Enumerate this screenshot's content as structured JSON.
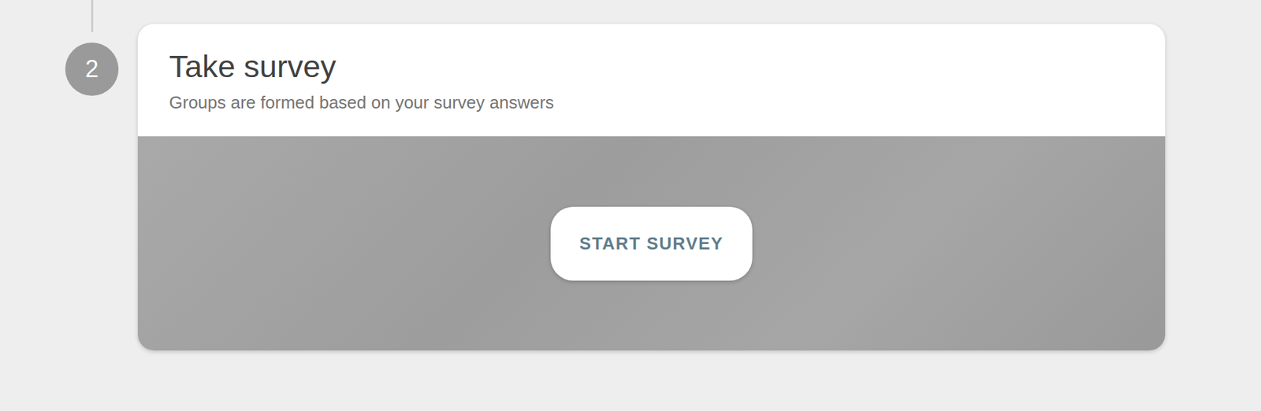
{
  "step": {
    "number": "2"
  },
  "card": {
    "title": "Take survey",
    "subtitle": "Groups are formed based on your survey answers",
    "button": "START SURVEY"
  }
}
